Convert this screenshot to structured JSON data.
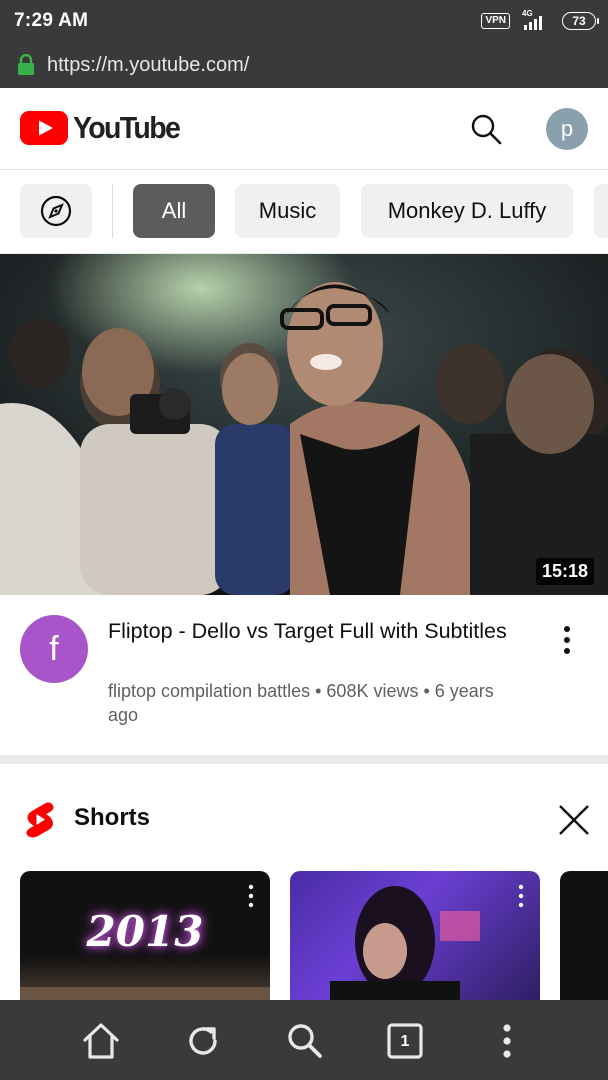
{
  "status_bar": {
    "time": "7:29 AM",
    "vpn": "VPN",
    "network": "4G",
    "battery": "73"
  },
  "browser": {
    "url": "https://m.youtube.com/",
    "lock_icon": "lock-icon"
  },
  "header": {
    "logo_text": "YouTube",
    "search_icon": "search-icon",
    "avatar_letter": "p"
  },
  "chips": {
    "explore_icon": "compass-icon",
    "items": [
      "All",
      "Music",
      "Monkey D. Luffy"
    ],
    "selected": "All"
  },
  "video": {
    "duration": "15:18",
    "channel_initial": "f",
    "title": "Fliptop - Dello vs Target Full with Subtitles",
    "meta": "fliptop compilation battles • 608K views • 6 years ago"
  },
  "shorts": {
    "title": "Shorts",
    "cards": [
      {
        "overlay_text": "2013"
      },
      {
        "overlay_text": ""
      },
      {
        "overlay_text": ""
      }
    ]
  },
  "bottom_nav": {
    "tab_count": "1",
    "icons": [
      "home-icon",
      "reload-icon",
      "search-icon",
      "tabs-icon",
      "menu-icon"
    ]
  },
  "colors": {
    "youtube_red": "#ff0000",
    "chrome_bar": "#3a3a3a",
    "chip_selected": "#5c5c5c",
    "chip_default": "#f0f0f0",
    "channel_avatar": "#a855c9",
    "user_avatar": "#8aa1ad",
    "lock_green": "#35b34a"
  }
}
